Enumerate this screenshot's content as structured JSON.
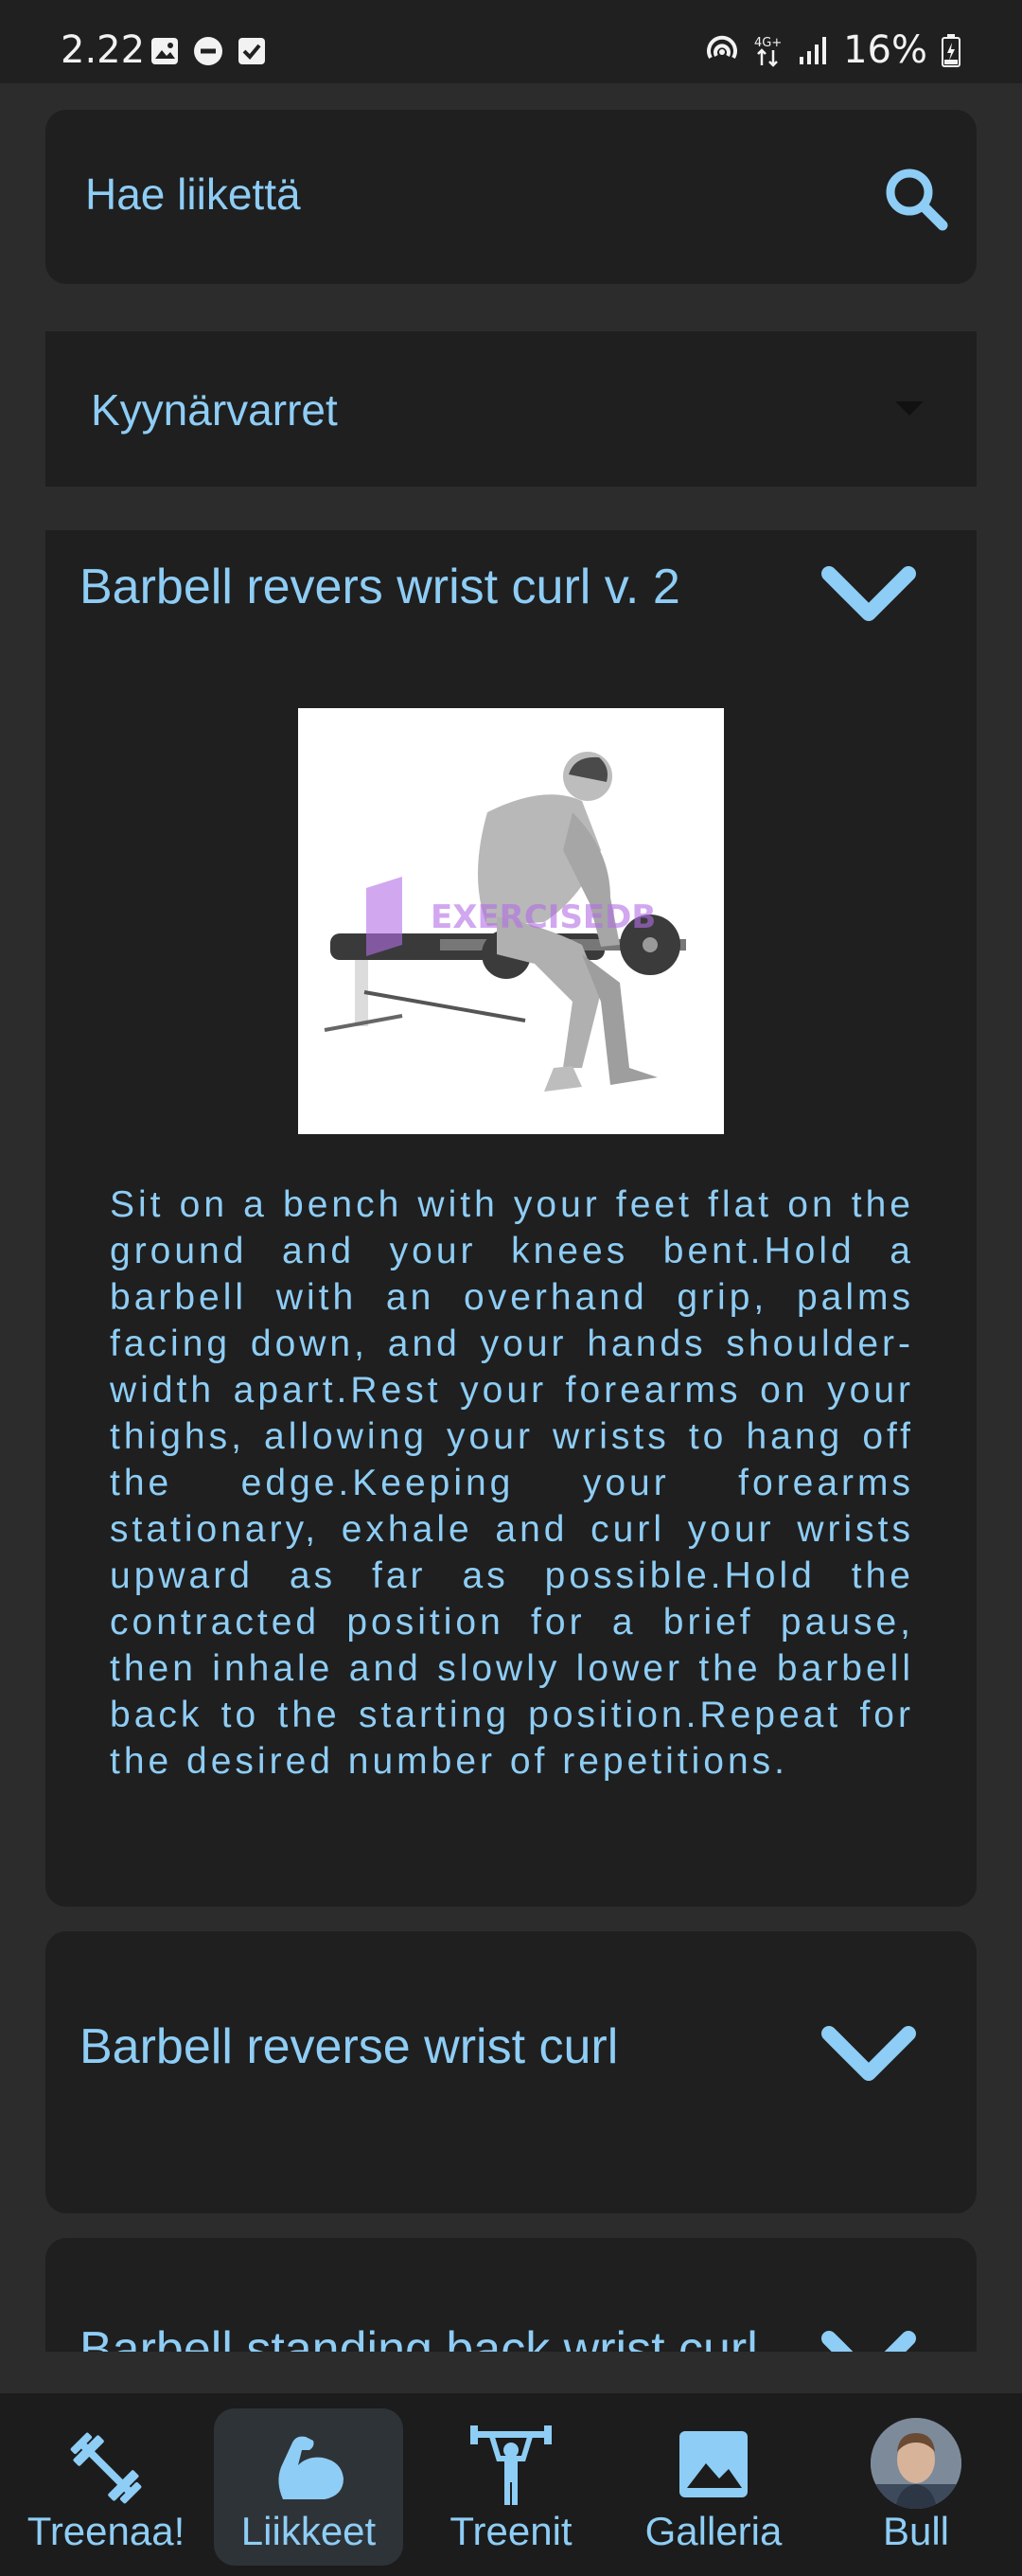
{
  "status_bar": {
    "time": "2.22",
    "battery": "16%",
    "network": "4G+"
  },
  "search": {
    "placeholder": "Hae liikettä"
  },
  "category": {
    "selected": "Kyynärvarret"
  },
  "exercises": [
    {
      "title": "Barbell revers wrist curl v. 2",
      "expanded": true,
      "image_watermark": "EXERCISEDB",
      "description": "Sit on a bench with your feet flat on the ground and your knees bent.Hold a barbell with an overhand grip, palms facing down, and your hands shoulder-width apart.Rest your forearms on your thighs, allowing your wrists to hang off the edge.Keeping your forearms stationary, exhale and curl your wrists upward as far as possible.Hold the contracted position for a brief pause, then inhale and slowly lower the barbell back to the starting position.Repeat for the desired number of repetitions."
    },
    {
      "title": "Barbell reverse wrist curl",
      "expanded": false
    },
    {
      "title": "Barbell standing back wrist curl",
      "expanded": false
    }
  ],
  "bottom_nav": [
    {
      "label": "Treenaa!",
      "icon": "dumbbell-icon",
      "active": false
    },
    {
      "label": "Liikkeet",
      "icon": "flexed-biceps-icon",
      "active": true
    },
    {
      "label": "Treenit",
      "icon": "weightlifter-icon",
      "active": false
    },
    {
      "label": "Galleria",
      "icon": "image-icon",
      "active": false
    },
    {
      "label": "Bull",
      "icon": "avatar",
      "active": false
    }
  ],
  "colors": {
    "accent": "#8ecdf5",
    "background": "#2c2c2c",
    "card": "#1f1f1f"
  }
}
